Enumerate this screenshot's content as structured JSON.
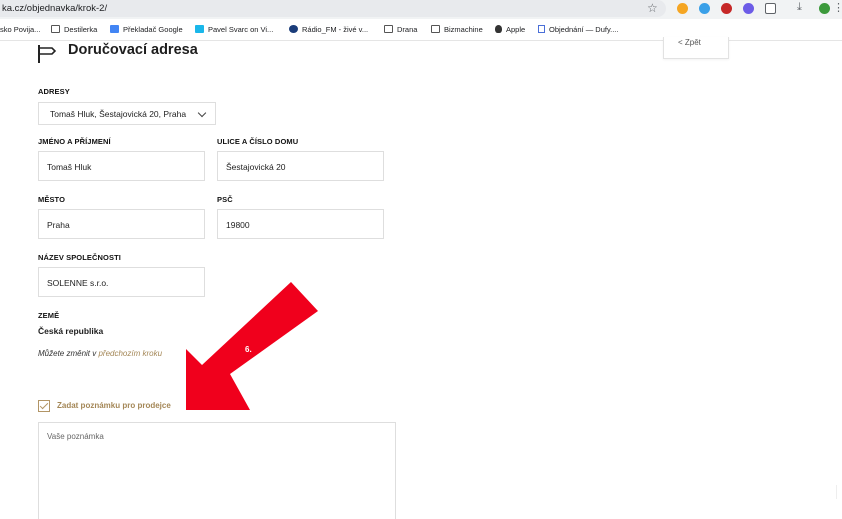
{
  "browser": {
    "url": "ka.cz/objednavka/krok-2/",
    "bookmarks": [
      {
        "label": "sko Povija...",
        "icon": "none"
      },
      {
        "label": "Destilerka",
        "icon": "folder-icon"
      },
      {
        "label": "Překladač Google",
        "icon": "translate-icon"
      },
      {
        "label": "Pavel Svarc on Vi...",
        "icon": "vimeo-icon"
      },
      {
        "label": "Rádio_FM - živé v...",
        "icon": "radio-icon"
      },
      {
        "label": "Drana",
        "icon": "folder-icon"
      },
      {
        "label": "Bizmachine",
        "icon": "folder-icon"
      },
      {
        "label": "Apple",
        "icon": "apple-icon"
      },
      {
        "label": "Objednání — Dufy....",
        "icon": "page-icon"
      }
    ],
    "colors": {
      "toolbar": "#f1f3f4",
      "accent": "#a48757"
    }
  },
  "page": {
    "back_label": "< Zpět",
    "title": "Doručovací adresa",
    "addresses": {
      "label": "ADRESY",
      "selected": "Tomaš Hluk, Šestajovická 20, Praha"
    },
    "name": {
      "label": "JMÉNO A PŘÍJMENÍ",
      "value": "Tomaš Hluk"
    },
    "street": {
      "label": "ULICE A ČÍSLO DOMU",
      "value": "Šestajovická 20"
    },
    "city": {
      "label": "MĚSTO",
      "value": "Praha"
    },
    "zip": {
      "label": "PSČ",
      "value": "19800"
    },
    "company": {
      "label": "NÁZEV SPOLEČNOSTI",
      "value": "SOLENNE s.r.o."
    },
    "country": {
      "label": "ZEMĚ",
      "value": "Česká republika"
    },
    "change_note": {
      "prefix": "Můžete změnit v ",
      "link": "předchozím kroku"
    },
    "note_checkbox": {
      "label": "Zadat poznámku pro prodejce",
      "checked": true
    },
    "note": {
      "placeholder": "Vaše poznámka"
    },
    "annotation": {
      "label": "6.",
      "color": "#f0001c"
    }
  }
}
